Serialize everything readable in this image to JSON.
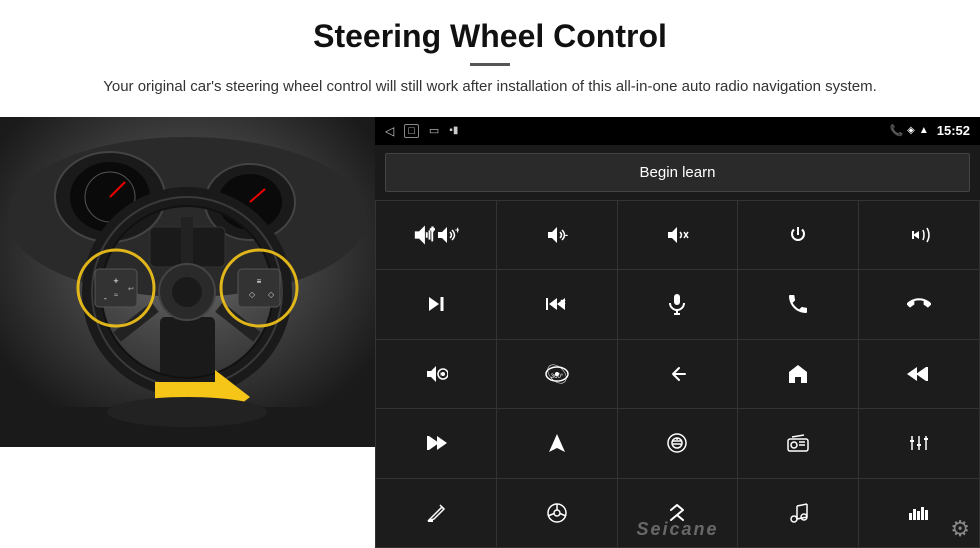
{
  "header": {
    "title": "Steering Wheel Control",
    "subtitle": "Your original car's steering wheel control will still work after installation of this all-in-one auto radio navigation system."
  },
  "head_unit": {
    "status_bar": {
      "back_icon": "◁",
      "home_icon": "□",
      "recent_icon": "▭",
      "signal_icon": "▪▮",
      "time": "15:52",
      "phone_icon": "📞",
      "location_icon": "◈",
      "wifi_icon": "▲"
    },
    "begin_learn_label": "Begin learn",
    "seicane_watermark": "Seicane",
    "controls": [
      {
        "id": "vol-up",
        "icon": "vol_up"
      },
      {
        "id": "vol-down",
        "icon": "vol_down"
      },
      {
        "id": "mute",
        "icon": "mute"
      },
      {
        "id": "power",
        "icon": "power"
      },
      {
        "id": "prev-track",
        "icon": "prev_track"
      },
      {
        "id": "next",
        "icon": "next"
      },
      {
        "id": "ff-prev",
        "icon": "ff_prev"
      },
      {
        "id": "mic",
        "icon": "mic"
      },
      {
        "id": "phone",
        "icon": "phone"
      },
      {
        "id": "hang-up",
        "icon": "hang_up"
      },
      {
        "id": "speaker",
        "icon": "speaker"
      },
      {
        "id": "360",
        "icon": "360"
      },
      {
        "id": "back",
        "icon": "back"
      },
      {
        "id": "home",
        "icon": "home"
      },
      {
        "id": "prev-ch",
        "icon": "prev_ch"
      },
      {
        "id": "fast-fwd",
        "icon": "fast_fwd"
      },
      {
        "id": "nav",
        "icon": "nav"
      },
      {
        "id": "eject",
        "icon": "eject"
      },
      {
        "id": "radio",
        "icon": "radio"
      },
      {
        "id": "eq",
        "icon": "eq"
      },
      {
        "id": "pen",
        "icon": "pen"
      },
      {
        "id": "steering",
        "icon": "steering"
      },
      {
        "id": "bluetooth",
        "icon": "bluetooth"
      },
      {
        "id": "music",
        "icon": "music"
      },
      {
        "id": "eq2",
        "icon": "eq2"
      }
    ]
  }
}
